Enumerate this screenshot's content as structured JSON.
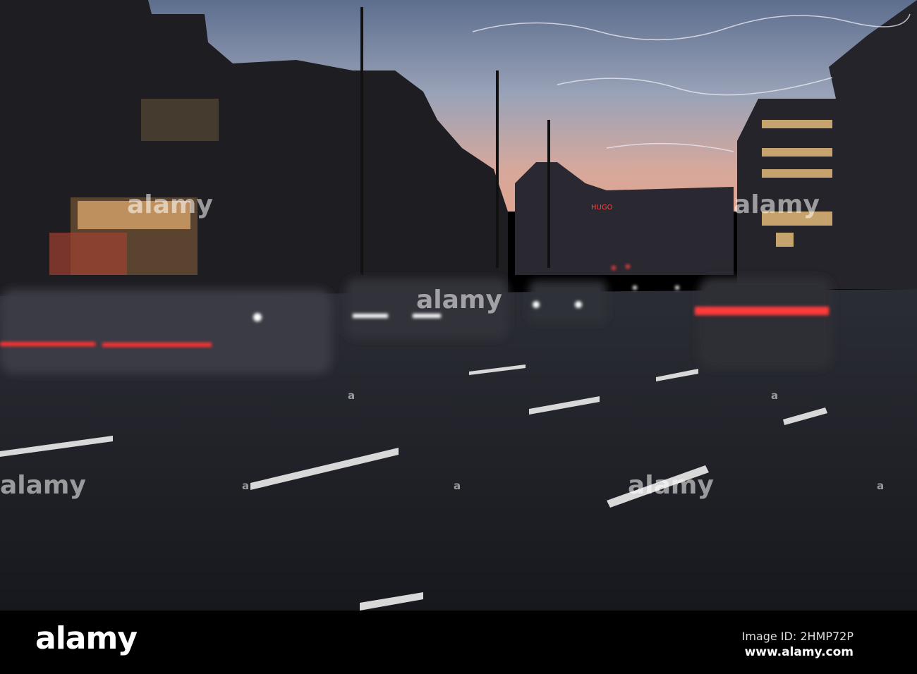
{
  "photo": {
    "description_tag": "night-city-street-traffic"
  },
  "watermark": {
    "text": "alamy",
    "small": "a"
  },
  "footer": {
    "logo": "alamy",
    "image_id": "Image ID: 2HMP72P",
    "url": "www.alamy.com"
  },
  "colors": {
    "sky_top": "#6f7f9c",
    "sky_glow": "#d9a79a",
    "road": "#1d1f26",
    "tail_light": "#ff3030"
  }
}
